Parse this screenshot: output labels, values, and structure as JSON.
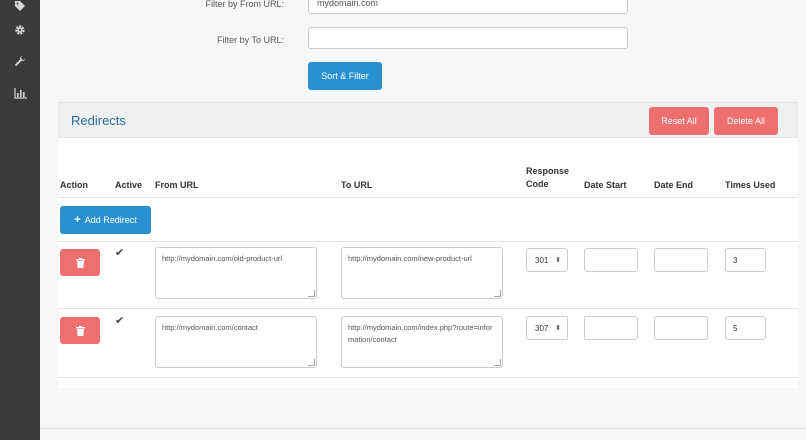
{
  "filters": {
    "from_label": "Filter by From URL:",
    "from_value": "mydomain.com",
    "to_label": "Filter by To URL:",
    "to_value": "",
    "sort_button": "Sort & Filter"
  },
  "panel": {
    "title": "Redirects",
    "reset_all": "Reset All",
    "delete_all": "Delete All"
  },
  "table": {
    "headers": {
      "action": "Action",
      "active": "Active",
      "from_url": "From URL",
      "to_url": "To URL",
      "response_code_1": "Response",
      "response_code_2": "Code",
      "date_start": "Date Start",
      "date_end": "Date End",
      "times_used": "Times Used"
    },
    "add_redirect": "Add Redirect",
    "rows": [
      {
        "from_url": "http://mydomain.com/old-product-url",
        "to_url": "http://mydomain.com/new-product-url",
        "response_code": "301",
        "date_start": "",
        "date_end": "",
        "times_used": "3"
      },
      {
        "from_url": "http://mydomain.com/contact",
        "to_url": "http://mydomain.com/index.php?route=information/contact",
        "response_code": "307",
        "date_start": "",
        "date_end": "",
        "times_used": "5"
      }
    ]
  },
  "icons": {
    "sidebar": [
      "tag-icon",
      "gear-icon",
      "wrench-icon",
      "bar-chart-icon"
    ],
    "row_action": "trash-icon",
    "active": "checkmark-icon",
    "add": "plus-icon",
    "select": "updown-arrow-icon"
  },
  "colors": {
    "sidebar": "#3a3a3a",
    "primary": "#2a91d0",
    "danger": "#ef6f6f",
    "panel_title": "#2b6ca3"
  }
}
